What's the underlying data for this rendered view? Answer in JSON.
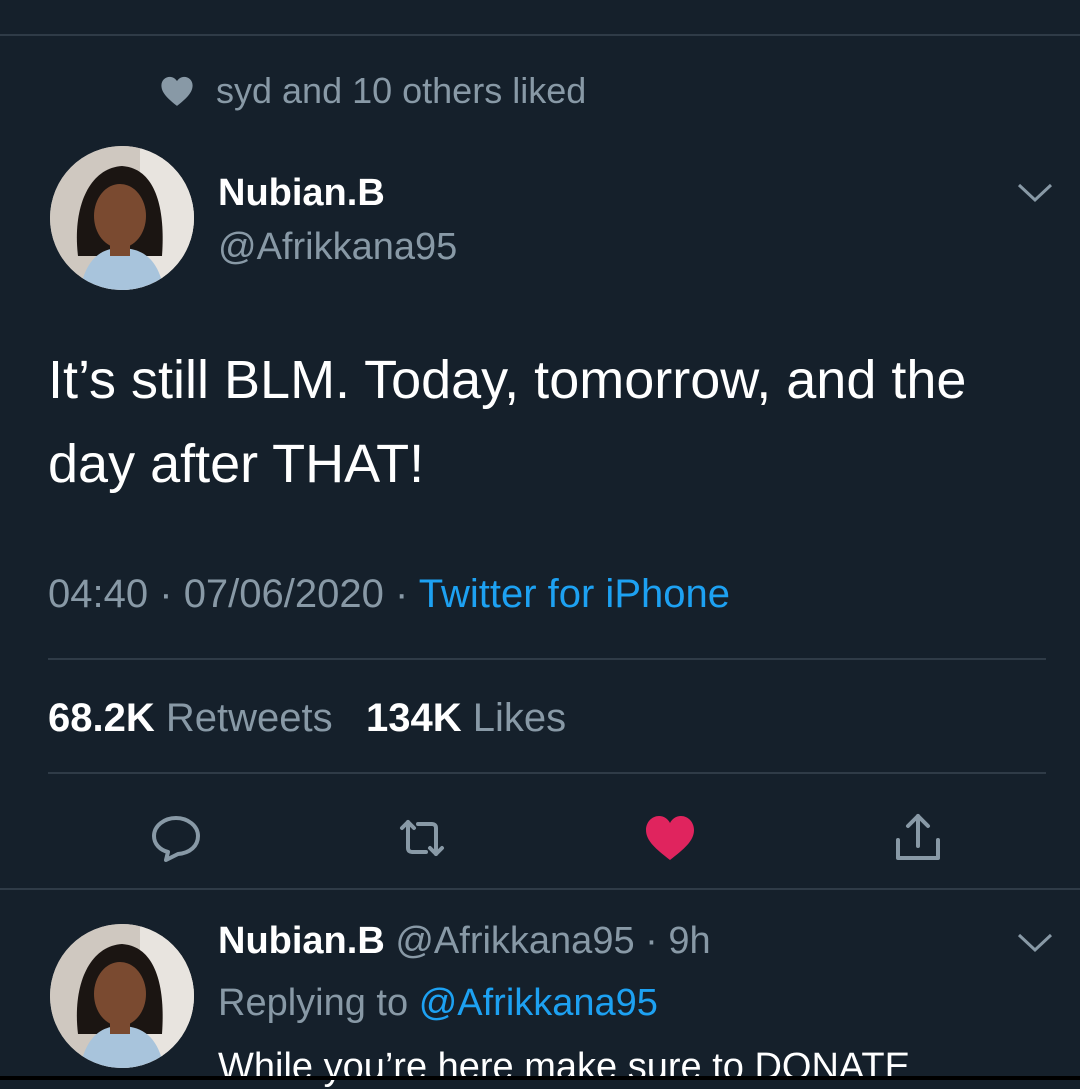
{
  "social_context": {
    "text": "syd and 10 others liked"
  },
  "tweet": {
    "author_name": "Nubian.B",
    "author_handle": "@Afrikkana95",
    "text": "It’s still BLM. Today, tomorrow, and the day after THAT!",
    "time": "04:40",
    "dot1": "·",
    "date": "07/06/2020",
    "dot2": "·",
    "source": "Twitter for iPhone",
    "retweets_count": "68.2K",
    "retweets_label": "Retweets",
    "likes_count": "134K",
    "likes_label": "Likes"
  },
  "reply": {
    "author_name": "Nubian.B",
    "meta": "@Afrikkana95 · 9h",
    "replying_label": "Replying to",
    "replying_to": "@Afrikkana95",
    "text_partial": "While you’re here make sure to DONATE"
  },
  "colors": {
    "background": "#15202b",
    "secondary_text": "#8899a6",
    "accent": "#1da1f2",
    "liked_heart": "#e0245e"
  },
  "icons": {
    "social_context": "heart-icon",
    "caret": "chevron-down-icon",
    "reply": "reply-icon",
    "retweet": "retweet-icon",
    "like": "heart-filled-icon",
    "share": "share-icon"
  }
}
